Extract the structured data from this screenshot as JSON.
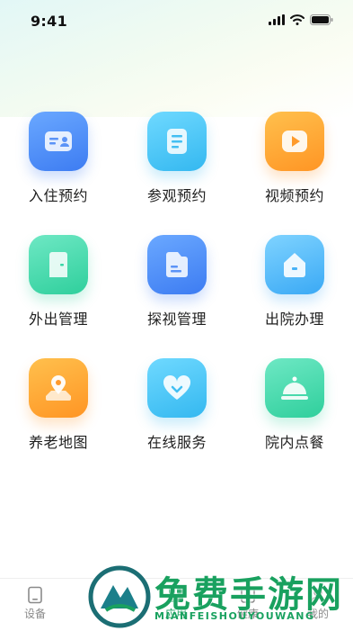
{
  "status_bar": {
    "time": "9:41"
  },
  "grid": [
    [
      {
        "label": "入住预约",
        "icon": "id-card-icon",
        "color": "#3d7cf2"
      },
      {
        "label": "参观预约",
        "icon": "document-icon",
        "color": "#34b8f0"
      },
      {
        "label": "视频预约",
        "icon": "video-play-icon",
        "color": "#ff9524"
      }
    ],
    [
      {
        "label": "外出管理",
        "icon": "door-icon",
        "color": "#2fcf9c"
      },
      {
        "label": "探视管理",
        "icon": "folder-icon",
        "color": "#3d7cf2"
      },
      {
        "label": "出院办理",
        "icon": "house-icon",
        "color": "#3aa9f5"
      }
    ],
    [
      {
        "label": "养老地图",
        "icon": "map-pin-icon",
        "color": "#ff9524"
      },
      {
        "label": "在线服务",
        "icon": "heart-icon",
        "color": "#34b8f0"
      },
      {
        "label": "院内点餐",
        "icon": "dish-cover-icon",
        "color": "#2fcf9c"
      }
    ]
  ],
  "tabbar": {
    "items": [
      {
        "label": "设备",
        "icon": "device-icon"
      },
      {
        "label": "报",
        "icon": "report-icon"
      },
      {
        "label": "应用",
        "icon": "apps-icon"
      },
      {
        "label": "健康",
        "icon": "health-icon"
      },
      {
        "label": "我的",
        "icon": "profile-icon"
      }
    ]
  },
  "watermark": {
    "title": "免费手游网",
    "subtitle": "MIANFEISHOUYOUWANG"
  }
}
